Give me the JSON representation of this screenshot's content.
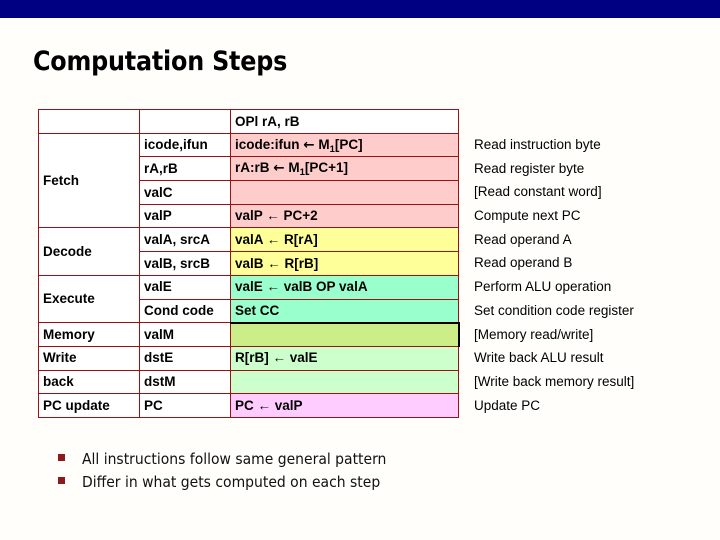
{
  "topbar": {
    "color": "#000082"
  },
  "slide": {
    "title": "Computation Steps"
  },
  "table": {
    "instruction_header": "OPl rA, rB",
    "rows": [
      {
        "stage": "Fetch",
        "field": "icode,ifun",
        "expr": "icode:ifun ← M₁[PC]",
        "note": "Read instruction byte",
        "band": "pink"
      },
      {
        "stage": "",
        "field": "rA,rB",
        "expr": "rA:rB ← M₁[PC+1]",
        "note": "Read register byte",
        "band": "pink"
      },
      {
        "stage": "",
        "field": "valC",
        "expr": "",
        "note": "[Read constant word]",
        "band": "pink"
      },
      {
        "stage": "",
        "field": "valP",
        "expr": "valP ← PC+2",
        "note": "Compute next PC",
        "band": "pink"
      },
      {
        "stage": "Decode",
        "field": "valA, srcA",
        "expr": "valA ← R[rA]",
        "note": "Read operand A",
        "band": "yellow"
      },
      {
        "stage": "",
        "field": "valB, srcB",
        "expr": "valB ← R[rB]",
        "note": "Read operand B",
        "band": "yellow"
      },
      {
        "stage": "Execute",
        "field": "valE",
        "expr": "valE ← valB OP valA",
        "note": "Perform ALU operation",
        "band": "mint"
      },
      {
        "stage": "",
        "field": "Cond code",
        "expr": "Set CC",
        "note": "Set condition code register",
        "band": "mint"
      },
      {
        "stage": "Memory",
        "field": "valM",
        "expr": "",
        "note": "[Memory read/write]",
        "band": "olive"
      },
      {
        "stage": "Write",
        "field": "dstE",
        "expr": "R[rB] ← valE",
        "note": "Write back ALU result",
        "band": "green"
      },
      {
        "stage": "back",
        "field": "dstM",
        "expr": "",
        "note": "[Write back memory result]",
        "band": "green"
      },
      {
        "stage": "PC update",
        "field": "PC",
        "expr": "PC ← valP",
        "note": "Update PC",
        "band": "magenta"
      }
    ],
    "colors": {
      "border": "#9c1111",
      "fetch_band": "#ffcccc",
      "decode_band": "#ffff99",
      "execute_band": "#99ffcc",
      "memory_band": "#ccee88",
      "writeback_band": "#ccffcc",
      "pcupdate_band": "#ffccff"
    }
  },
  "bullets": [
    "All instructions follow same general pattern",
    "Differ in what gets computed on each step"
  ]
}
